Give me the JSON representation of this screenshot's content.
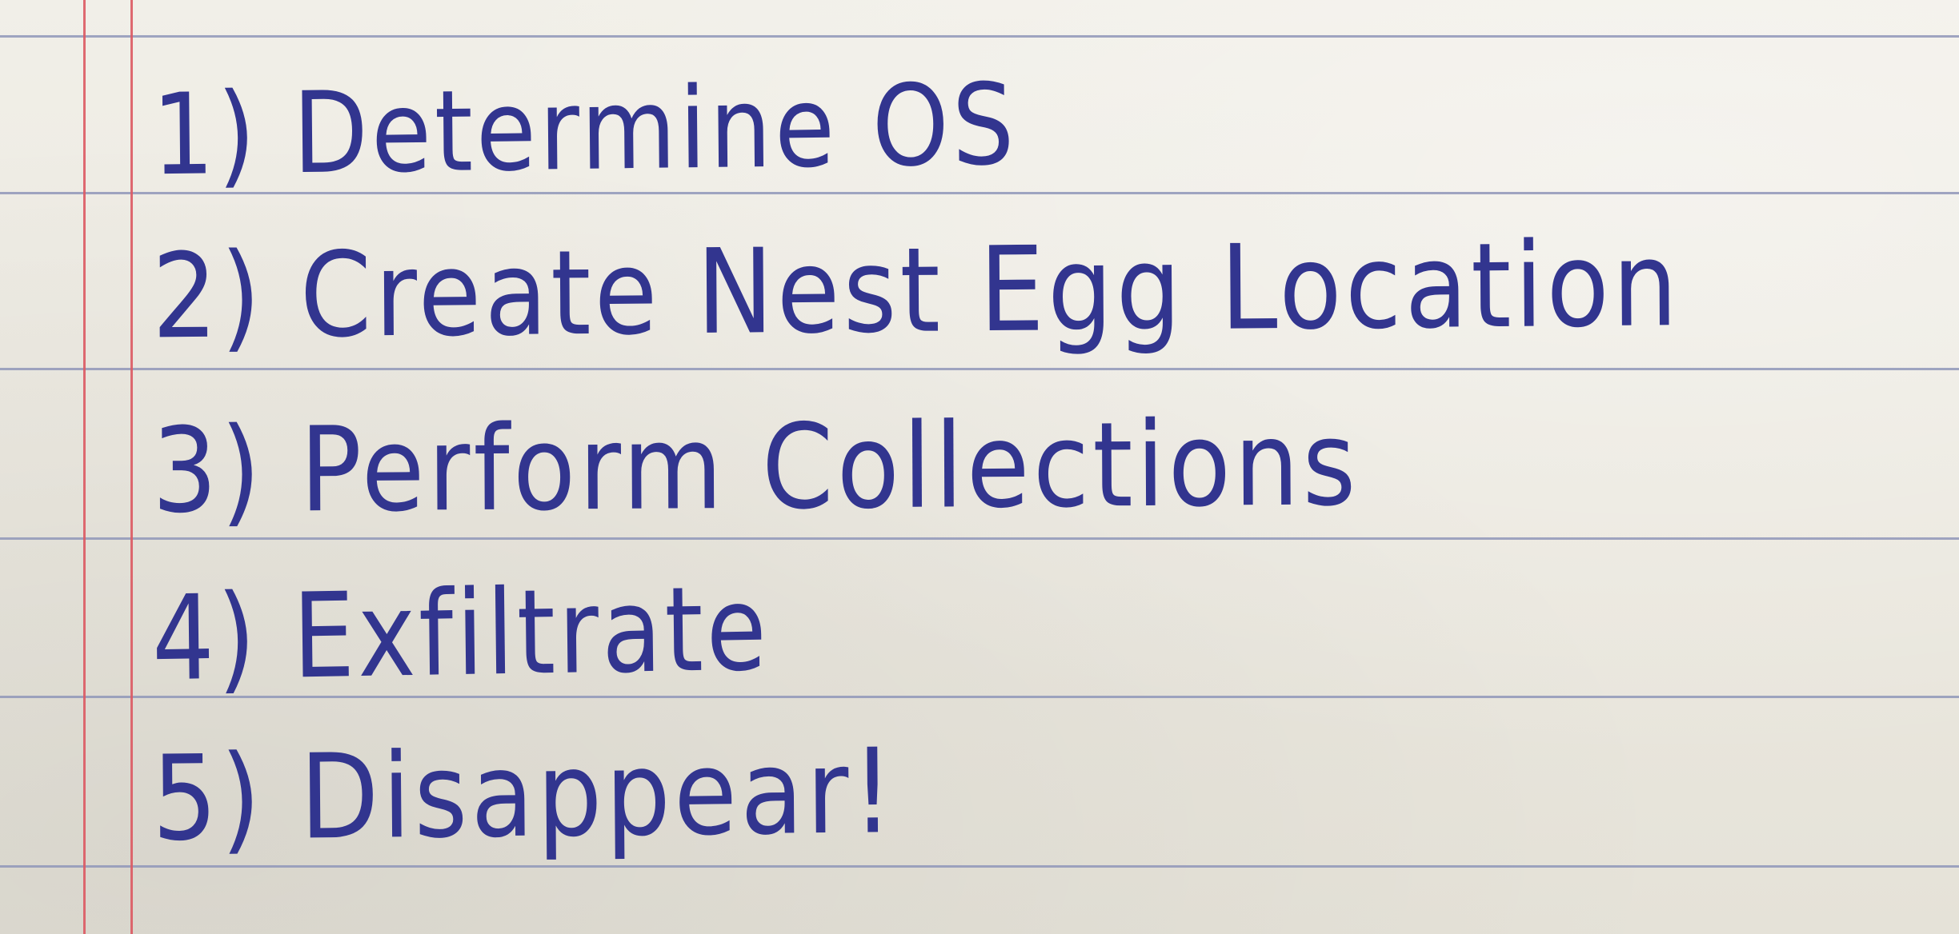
{
  "note": {
    "items": [
      {
        "text": "1) Determine OS"
      },
      {
        "text": "2) Create Nest Egg Location"
      },
      {
        "text": "3) Perform Collections"
      },
      {
        "text": "4) Exfiltrate"
      },
      {
        "text": "5) Disappear!"
      }
    ]
  },
  "colors": {
    "paper": "#ece9df",
    "rule_lines": "#8f97b8",
    "margin_lines": "#dc5a63",
    "ink": "#32358f"
  }
}
